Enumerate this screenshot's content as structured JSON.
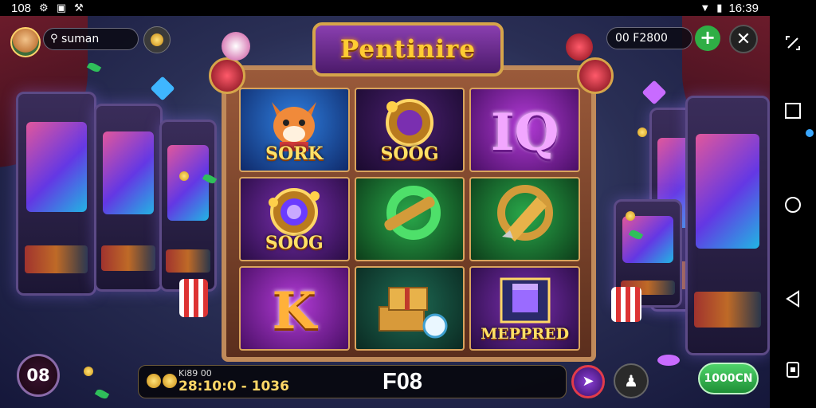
{
  "status_bar": {
    "time_left": "108",
    "time_right": "16:39",
    "icons": [
      "android-icon",
      "picture-icon",
      "tool-icon",
      "wifi-icon",
      "signal-icon",
      "battery-icon"
    ]
  },
  "header": {
    "username": "suman",
    "balance": "00 F2800",
    "title": "Pentinire"
  },
  "reels": [
    {
      "label": "SORK",
      "symbol": "fox",
      "bg": "blue"
    },
    {
      "label": "SOOG",
      "symbol": "medallion",
      "bg": "dark-purple"
    },
    {
      "label": "IQ",
      "symbol": "letters",
      "bg": "magenta"
    },
    {
      "label": "SOOG",
      "symbol": "gem-medallion",
      "bg": "purple"
    },
    {
      "label": "",
      "symbol": "scroll-ring",
      "bg": "green"
    },
    {
      "label": "",
      "symbol": "bell-ring",
      "bg": "green"
    },
    {
      "label": "K",
      "symbol": "letter",
      "bg": "magenta"
    },
    {
      "label": "",
      "symbol": "treasure-boxes",
      "bg": "teal"
    },
    {
      "label": "MEPPRED",
      "symbol": "gift-box",
      "bg": "purple"
    }
  ],
  "bottom": {
    "level": "08",
    "bet_label": "Ki89 00",
    "bet_value": "28:10:0 - 1036",
    "center": "F08",
    "green_button": "1000CN"
  },
  "nav": {
    "icons": [
      "screen-rotate-icon",
      "recents-icon",
      "home-icon",
      "back-icon",
      "screenshot-icon"
    ]
  },
  "colors": {
    "accent_gold": "#ffcc33",
    "green_button": "#2fae45",
    "frame_wood": "#9a5a3a"
  }
}
